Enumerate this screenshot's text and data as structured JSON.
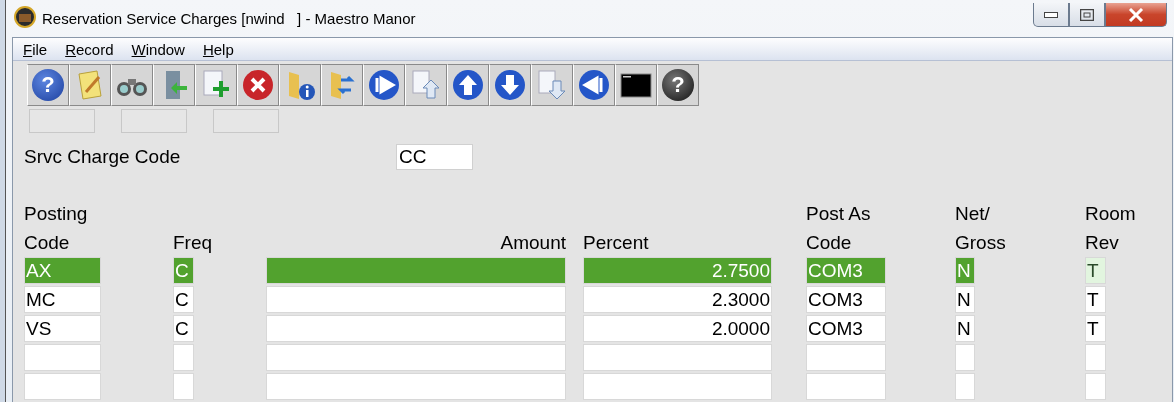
{
  "window": {
    "title": "Reservation Service Charges [nwind   ] - Maestro Manor"
  },
  "menu": [
    {
      "label": "File"
    },
    {
      "label": "Record"
    },
    {
      "label": "Window"
    },
    {
      "label": "Help"
    }
  ],
  "toolbar": [
    {
      "kind": "help",
      "glyph": "?"
    },
    {
      "kind": "notepad"
    },
    {
      "kind": "binoculars"
    },
    {
      "kind": "exit"
    },
    {
      "kind": "add"
    },
    {
      "kind": "delete"
    },
    {
      "kind": "folder-info"
    },
    {
      "kind": "folder-refresh"
    },
    {
      "kind": "first"
    },
    {
      "kind": "doc-up"
    },
    {
      "kind": "up"
    },
    {
      "kind": "down"
    },
    {
      "kind": "doc-down"
    },
    {
      "kind": "last"
    },
    {
      "kind": "console"
    },
    {
      "kind": "globe-help",
      "glyph": "?"
    }
  ],
  "srvc_charge_code": {
    "label": "Srvc Charge Code",
    "value": "CC"
  },
  "table": {
    "columns": [
      [
        "Posting",
        "Code"
      ],
      [
        "Freq"
      ],
      [
        "Amount"
      ],
      [
        "Percent"
      ],
      [
        "Post As",
        "Code"
      ],
      [
        "Net/",
        "Gross"
      ],
      [
        "Room",
        "Rev"
      ]
    ],
    "rows": [
      {
        "selected": true,
        "code": "AX",
        "freq": "C",
        "percent": "2.7500",
        "post_as": "COM3",
        "net_gross": "N",
        "room_rev": "T"
      },
      {
        "selected": false,
        "code": "MC",
        "freq": "C",
        "percent": "2.3000",
        "post_as": "COM3",
        "net_gross": "N",
        "room_rev": "T"
      },
      {
        "selected": false,
        "code": "VS",
        "freq": "C",
        "percent": "2.0000",
        "post_as": "COM3",
        "net_gross": "N",
        "room_rev": "T"
      },
      {
        "selected": false
      },
      {
        "selected": false
      }
    ]
  }
}
